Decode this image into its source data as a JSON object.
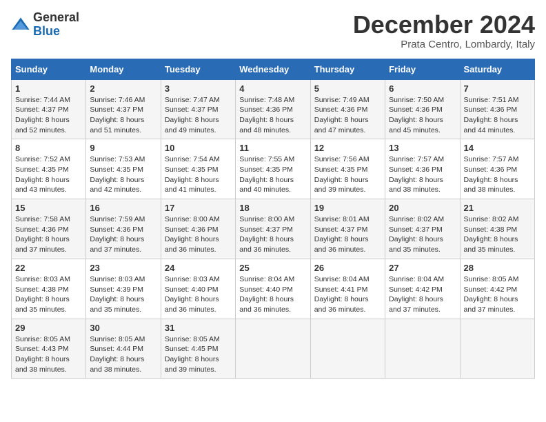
{
  "header": {
    "logo_general": "General",
    "logo_blue": "Blue",
    "month_title": "December 2024",
    "location": "Prata Centro, Lombardy, Italy"
  },
  "calendar": {
    "days_of_week": [
      "Sunday",
      "Monday",
      "Tuesday",
      "Wednesday",
      "Thursday",
      "Friday",
      "Saturday"
    ],
    "weeks": [
      [
        null,
        null,
        null,
        null,
        null,
        null,
        null
      ]
    ]
  },
  "days": [
    {
      "num": "1",
      "dow": 0,
      "sunrise": "7:44 AM",
      "sunset": "4:37 PM",
      "daylight": "8 hours and 52 minutes."
    },
    {
      "num": "2",
      "dow": 1,
      "sunrise": "7:46 AM",
      "sunset": "4:37 PM",
      "daylight": "8 hours and 51 minutes."
    },
    {
      "num": "3",
      "dow": 2,
      "sunrise": "7:47 AM",
      "sunset": "4:37 PM",
      "daylight": "8 hours and 49 minutes."
    },
    {
      "num": "4",
      "dow": 3,
      "sunrise": "7:48 AM",
      "sunset": "4:36 PM",
      "daylight": "8 hours and 48 minutes."
    },
    {
      "num": "5",
      "dow": 4,
      "sunrise": "7:49 AM",
      "sunset": "4:36 PM",
      "daylight": "8 hours and 47 minutes."
    },
    {
      "num": "6",
      "dow": 5,
      "sunrise": "7:50 AM",
      "sunset": "4:36 PM",
      "daylight": "8 hours and 45 minutes."
    },
    {
      "num": "7",
      "dow": 6,
      "sunrise": "7:51 AM",
      "sunset": "4:36 PM",
      "daylight": "8 hours and 44 minutes."
    },
    {
      "num": "8",
      "dow": 0,
      "sunrise": "7:52 AM",
      "sunset": "4:35 PM",
      "daylight": "8 hours and 43 minutes."
    },
    {
      "num": "9",
      "dow": 1,
      "sunrise": "7:53 AM",
      "sunset": "4:35 PM",
      "daylight": "8 hours and 42 minutes."
    },
    {
      "num": "10",
      "dow": 2,
      "sunrise": "7:54 AM",
      "sunset": "4:35 PM",
      "daylight": "8 hours and 41 minutes."
    },
    {
      "num": "11",
      "dow": 3,
      "sunrise": "7:55 AM",
      "sunset": "4:35 PM",
      "daylight": "8 hours and 40 minutes."
    },
    {
      "num": "12",
      "dow": 4,
      "sunrise": "7:56 AM",
      "sunset": "4:35 PM",
      "daylight": "8 hours and 39 minutes."
    },
    {
      "num": "13",
      "dow": 5,
      "sunrise": "7:57 AM",
      "sunset": "4:36 PM",
      "daylight": "8 hours and 38 minutes."
    },
    {
      "num": "14",
      "dow": 6,
      "sunrise": "7:57 AM",
      "sunset": "4:36 PM",
      "daylight": "8 hours and 38 minutes."
    },
    {
      "num": "15",
      "dow": 0,
      "sunrise": "7:58 AM",
      "sunset": "4:36 PM",
      "daylight": "8 hours and 37 minutes."
    },
    {
      "num": "16",
      "dow": 1,
      "sunrise": "7:59 AM",
      "sunset": "4:36 PM",
      "daylight": "8 hours and 37 minutes."
    },
    {
      "num": "17",
      "dow": 2,
      "sunrise": "8:00 AM",
      "sunset": "4:36 PM",
      "daylight": "8 hours and 36 minutes."
    },
    {
      "num": "18",
      "dow": 3,
      "sunrise": "8:00 AM",
      "sunset": "4:37 PM",
      "daylight": "8 hours and 36 minutes."
    },
    {
      "num": "19",
      "dow": 4,
      "sunrise": "8:01 AM",
      "sunset": "4:37 PM",
      "daylight": "8 hours and 36 minutes."
    },
    {
      "num": "20",
      "dow": 5,
      "sunrise": "8:02 AM",
      "sunset": "4:37 PM",
      "daylight": "8 hours and 35 minutes."
    },
    {
      "num": "21",
      "dow": 6,
      "sunrise": "8:02 AM",
      "sunset": "4:38 PM",
      "daylight": "8 hours and 35 minutes."
    },
    {
      "num": "22",
      "dow": 0,
      "sunrise": "8:03 AM",
      "sunset": "4:38 PM",
      "daylight": "8 hours and 35 minutes."
    },
    {
      "num": "23",
      "dow": 1,
      "sunrise": "8:03 AM",
      "sunset": "4:39 PM",
      "daylight": "8 hours and 35 minutes."
    },
    {
      "num": "24",
      "dow": 2,
      "sunrise": "8:03 AM",
      "sunset": "4:40 PM",
      "daylight": "8 hours and 36 minutes."
    },
    {
      "num": "25",
      "dow": 3,
      "sunrise": "8:04 AM",
      "sunset": "4:40 PM",
      "daylight": "8 hours and 36 minutes."
    },
    {
      "num": "26",
      "dow": 4,
      "sunrise": "8:04 AM",
      "sunset": "4:41 PM",
      "daylight": "8 hours and 36 minutes."
    },
    {
      "num": "27",
      "dow": 5,
      "sunrise": "8:04 AM",
      "sunset": "4:42 PM",
      "daylight": "8 hours and 37 minutes."
    },
    {
      "num": "28",
      "dow": 6,
      "sunrise": "8:05 AM",
      "sunset": "4:42 PM",
      "daylight": "8 hours and 37 minutes."
    },
    {
      "num": "29",
      "dow": 0,
      "sunrise": "8:05 AM",
      "sunset": "4:43 PM",
      "daylight": "8 hours and 38 minutes."
    },
    {
      "num": "30",
      "dow": 1,
      "sunrise": "8:05 AM",
      "sunset": "4:44 PM",
      "daylight": "8 hours and 38 minutes."
    },
    {
      "num": "31",
      "dow": 2,
      "sunrise": "8:05 AM",
      "sunset": "4:45 PM",
      "daylight": "8 hours and 39 minutes."
    }
  ],
  "labels": {
    "sunrise": "Sunrise:",
    "sunset": "Sunset:",
    "daylight": "Daylight:"
  }
}
